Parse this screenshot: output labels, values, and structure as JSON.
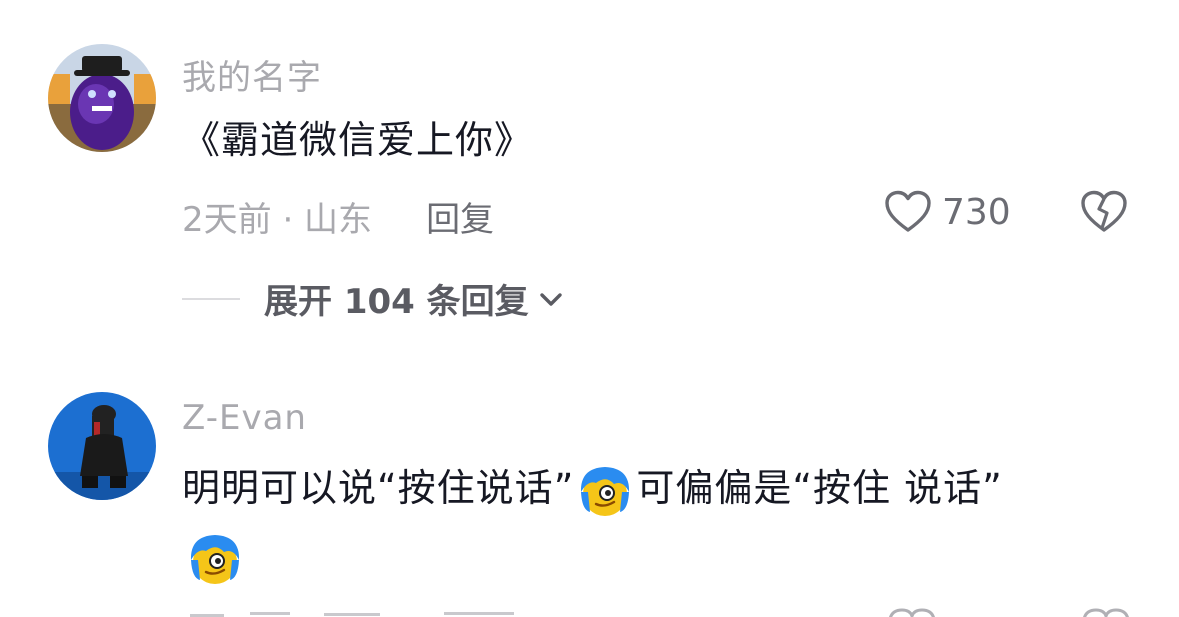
{
  "comments": [
    {
      "username": "我的名字",
      "text": "《霸道微信爱上你》",
      "time_location": "2天前 · 山东",
      "reply_label": "回复",
      "like_count": "730",
      "expand_label": "展开 104 条回复"
    },
    {
      "username": "Z-Evan",
      "text_part1": "明明可以说“按住说话”",
      "text_part2": "可偏偏是“按住  说话”"
    }
  ],
  "icons": {
    "heart": "heart-outline-icon",
    "broken_heart": "broken-heart-icon",
    "chevron": "chevron-down-icon",
    "emoji": "blue-hair-emoji"
  },
  "colors": {
    "username": "#a9a9ae",
    "text": "#161823",
    "meta": "#a9a9ae",
    "action": "#6b6c73",
    "emoji_hair": "#2a8cf0",
    "emoji_face": "#f5c518"
  }
}
